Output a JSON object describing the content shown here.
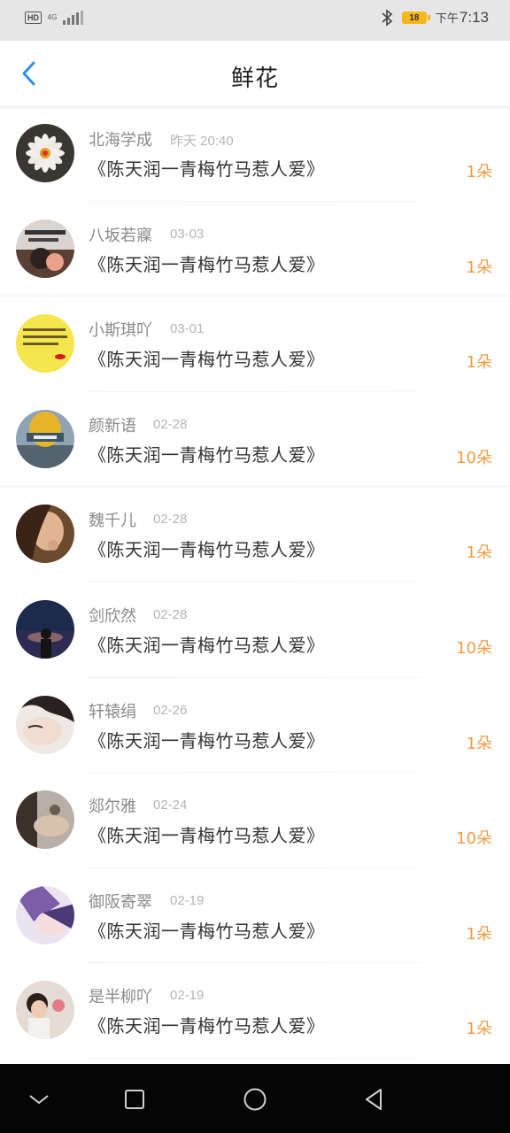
{
  "status_bar": {
    "hd": "HD",
    "network": "4G",
    "battery_level": "18",
    "ampm": "下午",
    "time": "7:13",
    "icons": [
      "hd-icon",
      "signal-icon",
      "bluetooth-icon",
      "battery-icon"
    ],
    "battery_color": "#f5b81b"
  },
  "header": {
    "title": "鲜花",
    "back_icon": "chevron-left-icon",
    "accent_color": "#2c8ff0"
  },
  "list": {
    "count_color": "#f39b43",
    "items": [
      {
        "name": "北海学成",
        "date": "昨天 20:40",
        "book": "《陈天润一青梅竹马惹人爱》",
        "count": "1朵"
      },
      {
        "name": "八坂若寱",
        "date": "03-03",
        "book": "《陈天润一青梅竹马惹人爱》",
        "count": "1朵"
      },
      {
        "name": "小斯琪吖",
        "date": "03-01",
        "book": "《陈天润一青梅竹马惹人爱》",
        "count": "1朵"
      },
      {
        "name": "颜新语",
        "date": "02-28",
        "book": "《陈天润一青梅竹马惹人爱》",
        "count": "10朵"
      },
      {
        "name": "魏千儿",
        "date": "02-28",
        "book": "《陈天润一青梅竹马惹人爱》",
        "count": "1朵"
      },
      {
        "name": "剑欣然",
        "date": "02-28",
        "book": "《陈天润一青梅竹马惹人爱》",
        "count": "10朵"
      },
      {
        "name": "轩辕绢",
        "date": "02-26",
        "book": "《陈天润一青梅竹马惹人爱》",
        "count": "1朵"
      },
      {
        "name": "郯尔雅",
        "date": "02-24",
        "book": "《陈天润一青梅竹马惹人爱》",
        "count": "10朵"
      },
      {
        "name": "御阪寄翠",
        "date": "02-19",
        "book": "《陈天润一青梅竹马惹人爱》",
        "count": "1朵"
      },
      {
        "name": "是半柳吖",
        "date": "02-19",
        "book": "《陈天润一青梅竹马惹人爱》",
        "count": "1朵"
      }
    ]
  },
  "nav_bar": {
    "icons": [
      "nav-down-icon",
      "recent-apps-icon",
      "home-icon",
      "back-triangle-icon"
    ]
  }
}
